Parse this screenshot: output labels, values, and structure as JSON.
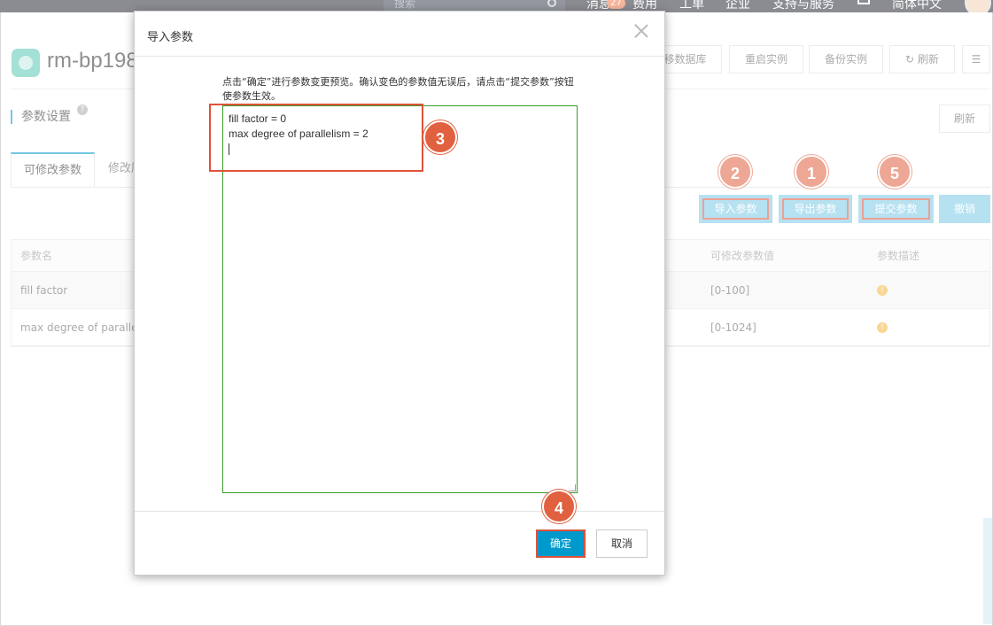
{
  "topnav": {
    "search_placeholder": "搜索",
    "items": [
      "消息",
      "费用",
      "工单",
      "企业",
      "支持与服务",
      "简体中文"
    ],
    "message_badge": "27"
  },
  "instance": {
    "title": "rm-bp198"
  },
  "header_buttons": [
    "迁移数据库",
    "重启实例",
    "备份实例",
    "刷新"
  ],
  "section": {
    "title": "参数设置",
    "refresh": "刷新"
  },
  "tabs": [
    "可修改参数",
    "修改历史"
  ],
  "actions": {
    "import": "导入参数",
    "export": "导出参数",
    "submit": "提交参数",
    "cancel": "撤销"
  },
  "steps": {
    "export": "1",
    "import": "2",
    "textarea": "3",
    "confirm": "4",
    "submit": "5"
  },
  "table": {
    "headers": [
      "参数名",
      "可修改参数值",
      "参数描述"
    ],
    "rows": [
      {
        "name": "fill factor",
        "range": "[0-100]"
      },
      {
        "name": "max degree of parallelism",
        "range": "[0-1024]"
      }
    ]
  },
  "modal": {
    "title": "导入参数",
    "description": "点击“确定”进行参数变更预览。确认变色的参数值无误后，请点击“提交参数”按钮使参数生效。",
    "textarea_lines": [
      "fill factor = 0",
      "max degree of parallelism = 2"
    ],
    "ok": "确定",
    "cancel": "取消"
  },
  "colors": {
    "accent": "#0099cc",
    "step": "#e0603f",
    "highlight": "#e0523a",
    "action_btn": "#78c8e5",
    "textarea_border": "#3a9b2b"
  }
}
